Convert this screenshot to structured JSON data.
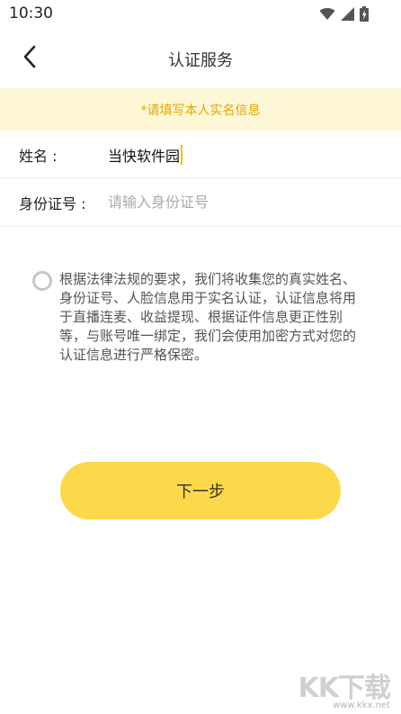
{
  "status_bar": {
    "time": "10:30",
    "icons": [
      "wifi-icon",
      "cellular-signal-icon",
      "battery-icon"
    ]
  },
  "nav": {
    "back_icon": "chevron-left-icon",
    "title": "认证服务"
  },
  "notice": {
    "text": "*请填写本人实名信息"
  },
  "form": {
    "name": {
      "label": "姓名 :",
      "value": "当快软件园"
    },
    "id_number": {
      "label": "身份证号 :",
      "placeholder": "请输入身份证号",
      "value": ""
    }
  },
  "agreement": {
    "checked": false,
    "text": "根据法律法规的要求，我们将收集您的真实姓名、身份证号、人脸信息用于实名认证，认证信息将用于直播连麦、收益提现、根据证件信息更正性别等，与账号唯一绑定，我们会使用加密方式对您的认证信息进行严格保密。"
  },
  "next_button": {
    "label": "下一步"
  },
  "watermark": {
    "main": "KK下载",
    "url": "www.kkx.net"
  },
  "colors": {
    "accent": "#fcd94a",
    "notice_bg": "#fdf7d6",
    "notice_text": "#e5a600",
    "placeholder": "#aaaaaa"
  }
}
